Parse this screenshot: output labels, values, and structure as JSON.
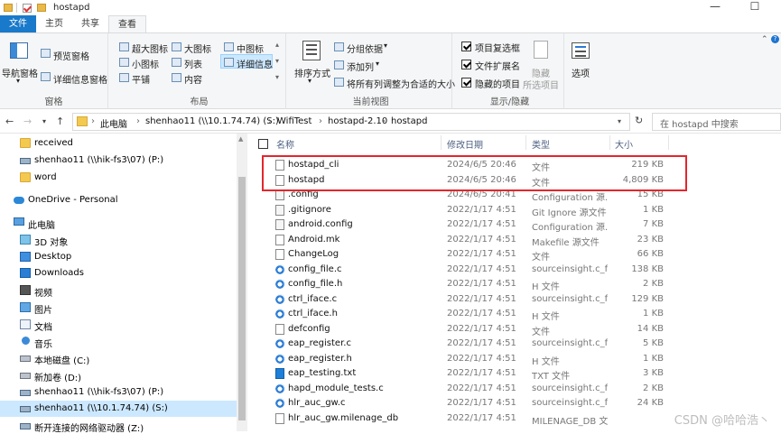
{
  "window": {
    "title": "hostapd",
    "minimize": "—",
    "maximize": "☐"
  },
  "tabs": [
    "文件",
    "主页",
    "共享",
    "查看"
  ],
  "ribbon": {
    "panes": {
      "nav_pane": "导航窗格",
      "preview": "预览窗格",
      "details": "详细信息窗格",
      "label": "窗格"
    },
    "layout": {
      "xl_icons": "超大图标",
      "l_icons": "大图标",
      "m_icons": "中图标",
      "s_icons": "小图标",
      "list": "列表",
      "details": "详细信息",
      "tiles": "平铺",
      "content": "内容",
      "label": "布局"
    },
    "current_view": {
      "sort": "排序方式",
      "group": "分组依据",
      "add_col": "添加列",
      "fit_cols": "将所有列调整为合适的大小",
      "label": "当前视图"
    },
    "show_hide": {
      "checkboxes": "项目复选框",
      "extensions": "文件扩展名",
      "hidden": "隐藏的项目",
      "hide": "隐藏",
      "selected": "所选项目",
      "label": "显示/隐藏"
    },
    "options": "选项"
  },
  "address": {
    "crumbs": [
      "此电脑",
      "shenhao11 (\\\\10.1.74.74) (S:)",
      "WifiTest",
      "hostapd-2.10",
      "hostapd"
    ],
    "search_placeholder": "在 hostapd 中搜索"
  },
  "nav": [
    {
      "label": "received",
      "icon": "folder-icon"
    },
    {
      "label": "shenhao11 (\\\\hik-fs3\\07) (P:)",
      "icon": "network-drive-icon"
    },
    {
      "label": "word",
      "icon": "folder-icon"
    },
    {
      "label": "OneDrive - Personal",
      "icon": "onedrive-icon"
    },
    {
      "label": "此电脑",
      "icon": "pc-icon"
    },
    {
      "label": "3D 对象",
      "icon": "3d-objects-icon"
    },
    {
      "label": "Desktop",
      "icon": "desktop-icon"
    },
    {
      "label": "Downloads",
      "icon": "downloads-icon"
    },
    {
      "label": "视频",
      "icon": "video-icon"
    },
    {
      "label": "图片",
      "icon": "pictures-icon"
    },
    {
      "label": "文档",
      "icon": "documents-icon"
    },
    {
      "label": "音乐",
      "icon": "music-icon"
    },
    {
      "label": "本地磁盘 (C:)",
      "icon": "drive-icon"
    },
    {
      "label": "新加卷 (D:)",
      "icon": "drive-icon"
    },
    {
      "label": "shenhao11 (\\\\hik-fs3\\07) (P:)",
      "icon": "network-drive-icon"
    },
    {
      "label": "shenhao11 (\\\\10.1.74.74) (S:)",
      "icon": "network-drive-icon"
    },
    {
      "label": "断开连接的网络驱动器 (Z:)",
      "icon": "network-drive-icon"
    }
  ],
  "columns": {
    "name": "名称",
    "date": "修改日期",
    "type": "类型",
    "size": "大小"
  },
  "files": [
    {
      "name": "hostapd_cli",
      "date": "2024/6/5 20:46",
      "type": "文件",
      "size": "219 KB",
      "icon": "blank"
    },
    {
      "name": "hostapd",
      "date": "2024/6/5 20:46",
      "type": "文件",
      "size": "4,809 KB",
      "icon": "blank"
    },
    {
      "name": ".config",
      "date": "2024/6/5 20:41",
      "type": "Configuration 源...",
      "size": "15 KB",
      "icon": "cfg"
    },
    {
      "name": ".gitignore",
      "date": "2022/1/17 4:51",
      "type": "Git Ignore 源文件",
      "size": "1 KB",
      "icon": "cfg"
    },
    {
      "name": "android.config",
      "date": "2022/1/17 4:51",
      "type": "Configuration 源...",
      "size": "7 KB",
      "icon": "cfg"
    },
    {
      "name": "Android.mk",
      "date": "2022/1/17 4:51",
      "type": "Makefile 源文件",
      "size": "23 KB",
      "icon": "blank"
    },
    {
      "name": "ChangeLog",
      "date": "2022/1/17 4:51",
      "type": "文件",
      "size": "66 KB",
      "icon": "blank"
    },
    {
      "name": "config_file.c",
      "date": "2022/1/17 4:51",
      "type": "sourceinsight.c_f...",
      "size": "138 KB",
      "icon": "src"
    },
    {
      "name": "config_file.h",
      "date": "2022/1/17 4:51",
      "type": "H 文件",
      "size": "2 KB",
      "icon": "src"
    },
    {
      "name": "ctrl_iface.c",
      "date": "2022/1/17 4:51",
      "type": "sourceinsight.c_f...",
      "size": "129 KB",
      "icon": "src"
    },
    {
      "name": "ctrl_iface.h",
      "date": "2022/1/17 4:51",
      "type": "H 文件",
      "size": "1 KB",
      "icon": "src"
    },
    {
      "name": "defconfig",
      "date": "2022/1/17 4:51",
      "type": "文件",
      "size": "14 KB",
      "icon": "blank"
    },
    {
      "name": "eap_register.c",
      "date": "2022/1/17 4:51",
      "type": "sourceinsight.c_f...",
      "size": "5 KB",
      "icon": "src"
    },
    {
      "name": "eap_register.h",
      "date": "2022/1/17 4:51",
      "type": "H 文件",
      "size": "1 KB",
      "icon": "src"
    },
    {
      "name": "eap_testing.txt",
      "date": "2022/1/17 4:51",
      "type": "TXT 文件",
      "size": "3 KB",
      "icon": "txt"
    },
    {
      "name": "hapd_module_tests.c",
      "date": "2022/1/17 4:51",
      "type": "sourceinsight.c_f...",
      "size": "2 KB",
      "icon": "src"
    },
    {
      "name": "hlr_auc_gw.c",
      "date": "2022/1/17 4:51",
      "type": "sourceinsight.c_f...",
      "size": "24 KB",
      "icon": "src"
    },
    {
      "name": "hlr_auc_gw.milenage_db",
      "date": "2022/1/17 4:51",
      "type": "MILENAGE_DB 文件",
      "size": "",
      "icon": "blank"
    }
  ],
  "watermark": "CSDN @哈哈浩丶"
}
